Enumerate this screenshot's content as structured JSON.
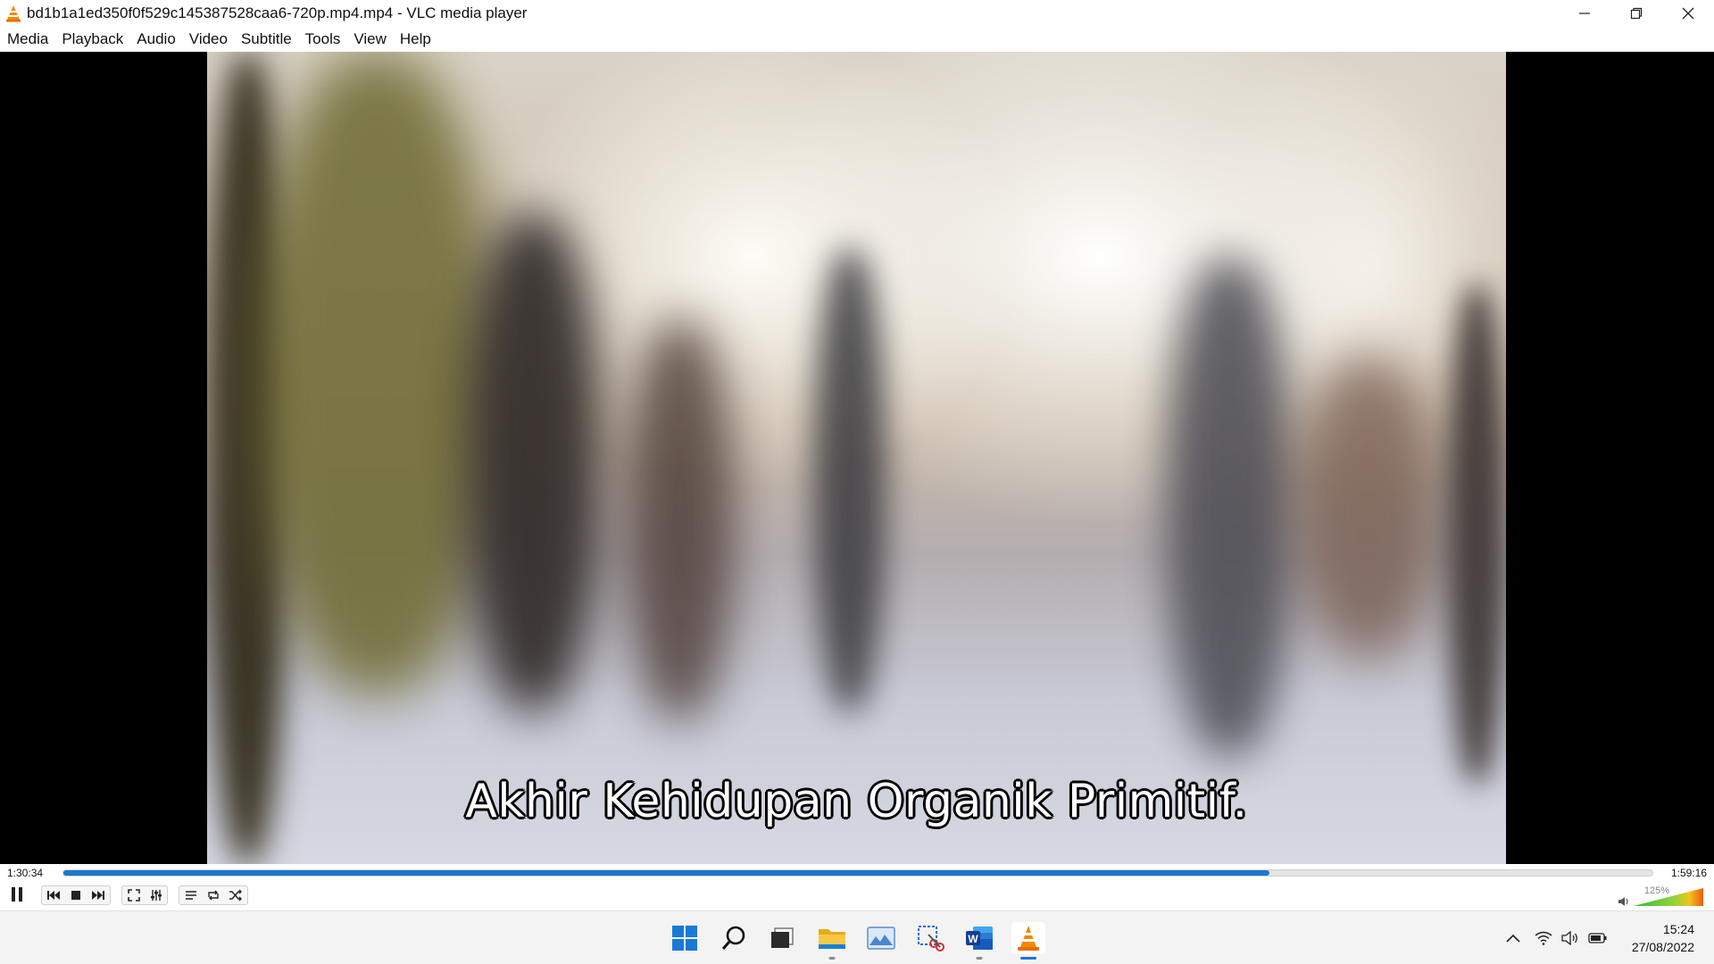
{
  "window": {
    "title": "bd1b1a1ed350f0f529c145387528caa6-720p.mp4.mp4 - VLC media player",
    "app_icon": "vlc-cone-icon",
    "controls": [
      "minimize-icon",
      "restore-icon",
      "close-icon"
    ]
  },
  "menu": [
    "Media",
    "Playback",
    "Audio",
    "Video",
    "Subtitle",
    "Tools",
    "View",
    "Help"
  ],
  "video": {
    "subtitle": "Akhir Kehidupan Organik Primitif."
  },
  "seek": {
    "elapsed": "1:30:34",
    "total": "1:59:16",
    "progress_fraction": 0.759,
    "accent": "#1e76d2"
  },
  "controls": {
    "buttons": [
      "pause-icon",
      "previous-icon",
      "stop-icon",
      "next-icon",
      "fullscreen-icon",
      "extended-settings-icon",
      "playlist-icon",
      "loop-icon",
      "shuffle-icon"
    ],
    "volume_label": "125%",
    "volume_fraction": 1.0
  },
  "taskbar": {
    "apps": [
      "windows-start-icon",
      "search-icon",
      "task-view-icon",
      "file-explorer-icon",
      "photos-icon",
      "snipping-tool-icon",
      "word-icon",
      "vlc-icon"
    ],
    "clock_time": "15:24",
    "clock_date": "27/08/2022",
    "tray": [
      "chevron-up-icon",
      "wifi-icon",
      "speaker-icon",
      "battery-icon"
    ]
  }
}
